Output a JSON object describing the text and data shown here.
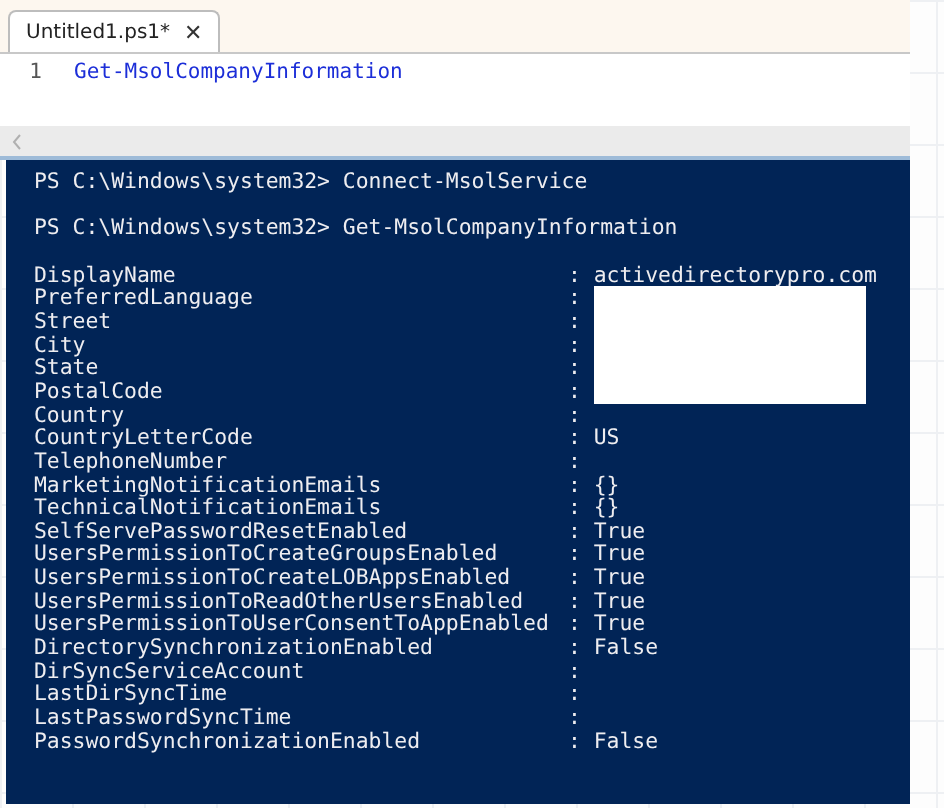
{
  "editor": {
    "tabs": [
      {
        "label": "Untitled1.ps1*",
        "close": "✕",
        "selected": true
      }
    ],
    "lines": [
      {
        "number": "1",
        "code": "Get-MsolCompanyInformation"
      }
    ]
  },
  "console": {
    "commands": [
      {
        "prompt": "PS C:\\Windows\\system32>",
        "command": "Connect-MsolService"
      },
      {
        "prompt": "PS C:\\Windows\\system32>",
        "command": "Get-MsolCompanyInformation"
      }
    ],
    "properties": [
      {
        "name": "DisplayName",
        "value": "activedirectorypro.com",
        "redacted": false
      },
      {
        "name": "PreferredLanguage",
        "redacted": true
      },
      {
        "name": "Street",
        "redacted": true
      },
      {
        "name": "City",
        "redacted": true
      },
      {
        "name": "State",
        "redacted": true
      },
      {
        "name": "PostalCode",
        "redacted": true
      },
      {
        "name": "Country",
        "redacted": false
      },
      {
        "name": "CountryLetterCode",
        "value": "US",
        "redacted": false
      },
      {
        "name": "TelephoneNumber",
        "redacted": false
      },
      {
        "name": "MarketingNotificationEmails",
        "value": "{}",
        "redacted": false
      },
      {
        "name": "TechnicalNotificationEmails",
        "value": "{}",
        "redacted": false
      },
      {
        "name": "SelfServePasswordResetEnabled",
        "value": "True",
        "redacted": false
      },
      {
        "name": "UsersPermissionToCreateGroupsEnabled",
        "value": "True",
        "redacted": false
      },
      {
        "name": "UsersPermissionToCreateLOBAppsEnabled",
        "value": "True",
        "redacted": false
      },
      {
        "name": "UsersPermissionToReadOtherUsersEnabled",
        "value": "True",
        "redacted": false
      },
      {
        "name": "UsersPermissionToUserConsentToAppEnabled",
        "value": "True",
        "redacted": false
      },
      {
        "name": "DirectorySynchronizationEnabled",
        "value": "False",
        "redacted": false
      },
      {
        "name": "DirSyncServiceAccount",
        "redacted": false
      },
      {
        "name": "LastDirSyncTime",
        "redacted": false
      },
      {
        "name": "LastPasswordSyncTime",
        "redacted": false
      },
      {
        "name": "PasswordSynchronizationEnabled",
        "value": "False",
        "redacted": false
      }
    ],
    "separator": ":"
  }
}
